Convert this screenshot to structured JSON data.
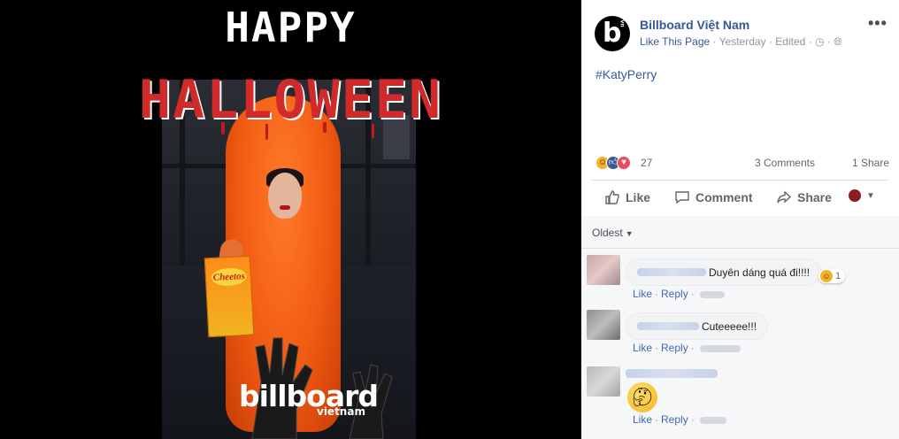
{
  "viewer": {
    "title_line1": "HAPPY",
    "title_line2": "HALLOWEEN",
    "bag_label": "Cheetos",
    "logo_text": "billboard",
    "logo_sub": "vietnam"
  },
  "post": {
    "page_name": "Billboard Việt Nam",
    "like_page": "Like This Page",
    "time": "Yesterday",
    "edited": "Edited",
    "more": "•••",
    "hashtag": "#KatyPerry",
    "reaction_count": "27",
    "comments": "3 Comments",
    "shares": "1 Share",
    "actions": {
      "like": "Like",
      "comment": "Comment",
      "share": "Share"
    }
  },
  "comments_section": {
    "sort_label": "Oldest",
    "items": [
      {
        "text": "Duyên dáng quá đi!!!!",
        "reaction_count": "1",
        "like": "Like",
        "reply": "Reply"
      },
      {
        "text": "Cuteeeee!!!",
        "like": "Like",
        "reply": "Reply"
      },
      {
        "text": "",
        "like": "Like",
        "reply": "Reply"
      }
    ]
  },
  "colors": {
    "link": "#365899",
    "muted": "#90949c",
    "accent_orange": "#f15a12"
  }
}
